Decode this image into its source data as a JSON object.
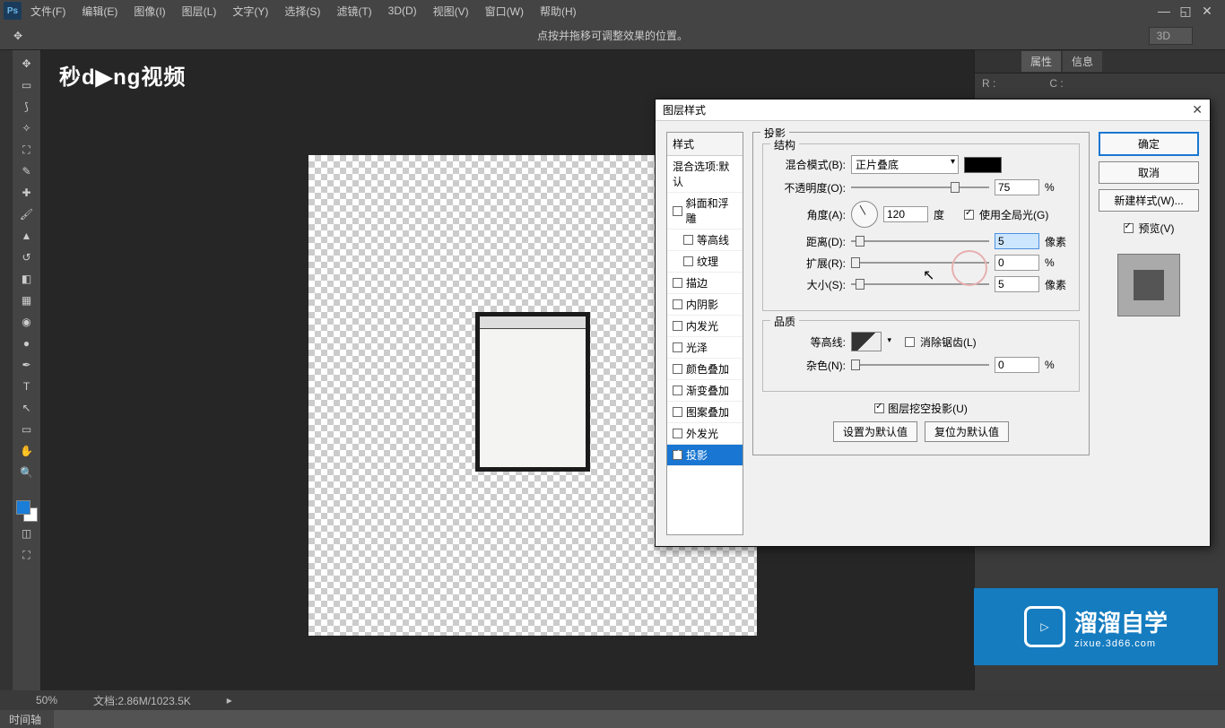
{
  "menubar": {
    "items": [
      "文件(F)",
      "编辑(E)",
      "图像(I)",
      "图层(L)",
      "文字(Y)",
      "选择(S)",
      "滤镜(T)",
      "3D(D)",
      "视图(V)",
      "窗口(W)",
      "帮助(H)"
    ]
  },
  "optionsBar": {
    "hint": "点按并拖移可调整效果的位置。",
    "rightSelect": "3D"
  },
  "rightPanel": {
    "tabs": [
      "属性",
      "信息"
    ],
    "r_label": "R :",
    "c_label": "C :"
  },
  "statusBar": {
    "zoom": "50%",
    "docinfo": "文档:2.86M/1023.5K",
    "timeline": "时间轴"
  },
  "watermark1": "秒d▶ng视频",
  "brand": {
    "big": "溜溜自学",
    "small": "zixue.3d66.com"
  },
  "dialog": {
    "title": "图层样式",
    "styleHeader": "样式",
    "blendOpts": "混合选项:默认",
    "styles": [
      {
        "label": "斜面和浮雕",
        "checked": false,
        "indent": false
      },
      {
        "label": "等高线",
        "checked": false,
        "indent": true
      },
      {
        "label": "纹理",
        "checked": false,
        "indent": true
      },
      {
        "label": "描边",
        "checked": false,
        "indent": false
      },
      {
        "label": "内阴影",
        "checked": false,
        "indent": false
      },
      {
        "label": "内发光",
        "checked": false,
        "indent": false
      },
      {
        "label": "光泽",
        "checked": false,
        "indent": false
      },
      {
        "label": "颜色叠加",
        "checked": false,
        "indent": false
      },
      {
        "label": "渐变叠加",
        "checked": false,
        "indent": false
      },
      {
        "label": "图案叠加",
        "checked": false,
        "indent": false
      },
      {
        "label": "外发光",
        "checked": false,
        "indent": false
      },
      {
        "label": "投影",
        "checked": true,
        "indent": false,
        "selected": true
      }
    ],
    "group_shadow": "投影",
    "group_structure": "结构",
    "group_quality": "品质",
    "blendMode_label": "混合模式(B):",
    "blendMode_value": "正片叠底",
    "opacity_label": "不透明度(O):",
    "opacity_value": "75",
    "opacity_unit": "%",
    "angle_label": "角度(A):",
    "angle_value": "120",
    "angle_unit": "度",
    "globalLight_label": "使用全局光(G)",
    "distance_label": "距离(D):",
    "distance_value": "5",
    "distance_unit": "像素",
    "spread_label": "扩展(R):",
    "spread_value": "0",
    "spread_unit": "%",
    "size_label": "大小(S):",
    "size_value": "5",
    "size_unit": "像素",
    "contour_label": "等高线:",
    "antialias_label": "消除锯齿(L)",
    "noise_label": "杂色(N):",
    "noise_value": "0",
    "noise_unit": "%",
    "knockout_label": "图层挖空投影(U)",
    "setDefault": "设置为默认值",
    "resetDefault": "复位为默认值",
    "buttons": {
      "ok": "确定",
      "cancel": "取消",
      "newStyle": "新建样式(W)...",
      "preview": "预览(V)"
    }
  }
}
